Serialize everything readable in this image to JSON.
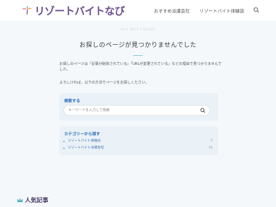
{
  "header": {
    "logo_text": "リゾートバイトなび",
    "nav": [
      "おすすめ派遣会社",
      "リゾートバイト体験談"
    ]
  },
  "main": {
    "eyebrow": "404 NOT FOUND",
    "title": "お探しのページが見つかりませんでした",
    "para1": "お探しのページは「記事が削除されている」「URLが変更されている」などの理由で見つかりませんでした。",
    "para2": "よろしければ、以下の方法でページをお探しください。",
    "search": {
      "title": "検索する",
      "placeholder": "キーワードを入力して検索"
    },
    "categories": {
      "title": "カテゴリーから探す",
      "items": [
        {
          "label": "リゾートバイト体験談",
          "count": "5"
        },
        {
          "label": "リゾートバイト派遣会社",
          "count": "16"
        }
      ]
    }
  },
  "footer": {
    "popular": "人気記事"
  },
  "colors": {
    "brand": "#6c4f8f",
    "accent": "#2a6fb5",
    "bg_light": "#f5f8fb",
    "card": "#eaf1f7"
  }
}
